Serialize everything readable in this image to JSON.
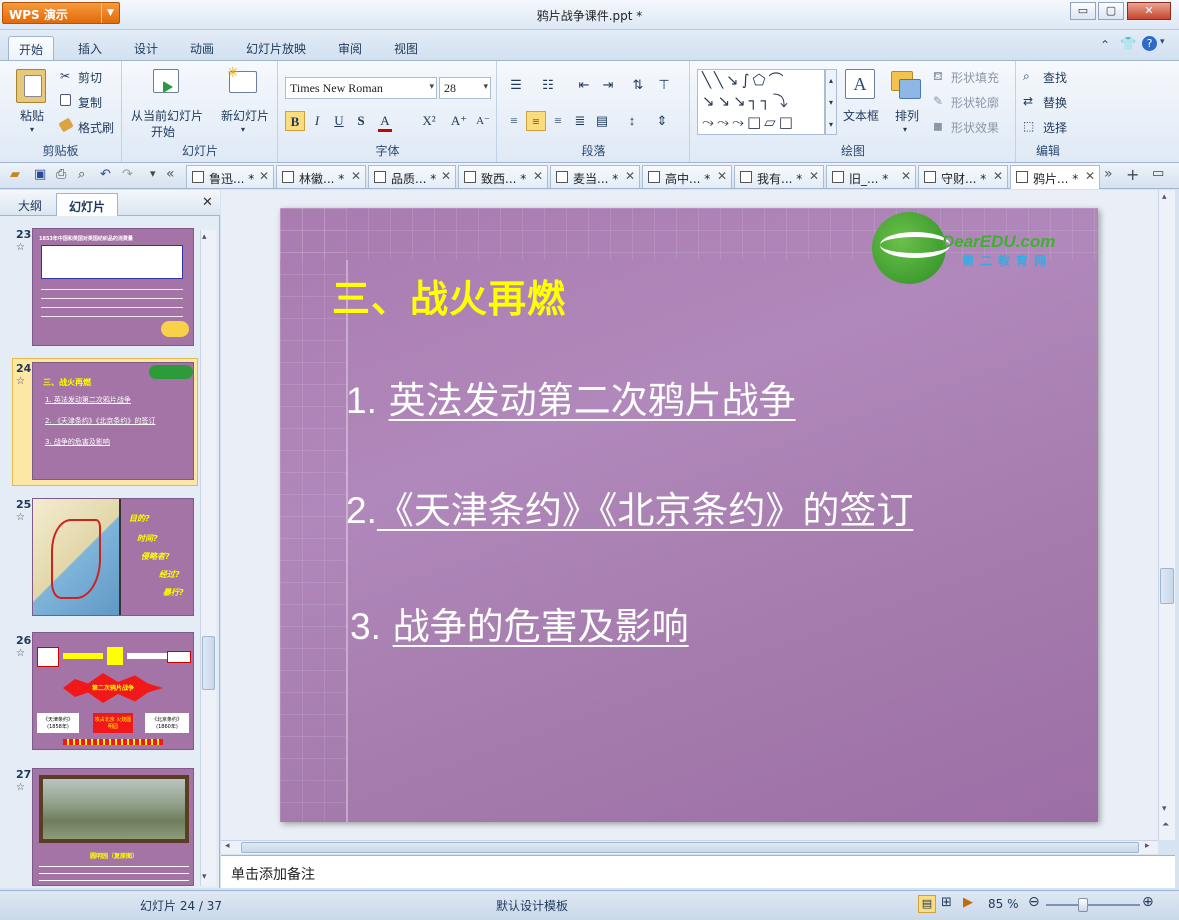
{
  "app": {
    "name": "WPS 演示",
    "doc_title": "鸦片战争课件.ppt *"
  },
  "window_controls": {
    "minimize": "▭",
    "maximize": "▢",
    "close": "✕"
  },
  "ribbon_tabs": [
    "开始",
    "插入",
    "设计",
    "动画",
    "幻灯片放映",
    "审阅",
    "视图"
  ],
  "ribbon": {
    "clipboard": {
      "paste": "粘贴",
      "cut": "剪切",
      "copy": "复制",
      "format_painter": "格式刷",
      "label": "剪贴板"
    },
    "slides": {
      "from_current_1": "从当前幻灯片",
      "from_current_2": "开始",
      "new_slide": "新幻灯片",
      "label": "幻灯片"
    },
    "font": {
      "name": "Times New Roman",
      "size": "28",
      "bold": "B",
      "italic": "I",
      "underline": "U",
      "shadow": "S",
      "label": "字体"
    },
    "paragraph": {
      "label": "段落"
    },
    "drawing": {
      "textbox": "文本框",
      "arrange": "排列",
      "shape_fill": "形状填充",
      "shape_outline": "形状轮廓",
      "shape_effects": "形状效果",
      "label": "绘图"
    },
    "edit": {
      "find": "查找",
      "replace": "替换",
      "select": "选择",
      "label": "编辑"
    }
  },
  "doc_tabs": [
    "鲁迅... *",
    "林徽... *",
    "品质... *",
    "致西... *",
    "麦当... *",
    "高中... *",
    "我有... *",
    "旧_... *",
    "守财... *",
    "鸦片... *"
  ],
  "left_pane": {
    "tabs": [
      "大纲",
      "幻灯片"
    ],
    "thumbs": [
      {
        "num": "23",
        "caption": "1853年中国和英国对英国纺织品的消费量"
      },
      {
        "num": "24",
        "title": "三、战火再燃",
        "items": [
          "1. 英法发动第二次鸦片战争",
          "2. 《天津条约》《北京条约》的签订",
          "3. 战争的危害及影响"
        ]
      },
      {
        "num": "25",
        "words": [
          "目的?",
          "时间?",
          "侵略者?",
          "经过?",
          "暴行?"
        ]
      },
      {
        "num": "26",
        "center": "第二次鸦片战争",
        "left_box": "《天津条约》(1858年)",
        "right_box": "《北京条约》(1860年)",
        "mid_box": "攻占北京 火烧圆明园"
      },
      {
        "num": "27",
        "caption": "圆明园（复原图）"
      }
    ]
  },
  "slide": {
    "logo_text": "DearEDU.com",
    "logo_sub": "第二教育网",
    "title": "三、战火再燃",
    "lines": [
      {
        "num": "1.",
        "text": "英法发动第二次鸦片战争"
      },
      {
        "num": "2.",
        "text": "《天津条约》《北京条约》的签订"
      },
      {
        "num": "3.",
        "text": "战争的危害及影响"
      }
    ]
  },
  "notes_placeholder": "单击添加备注",
  "status": {
    "slide_pos": "幻灯片 24 / 37",
    "template": "默认设计模板",
    "zoom": "85 %"
  }
}
